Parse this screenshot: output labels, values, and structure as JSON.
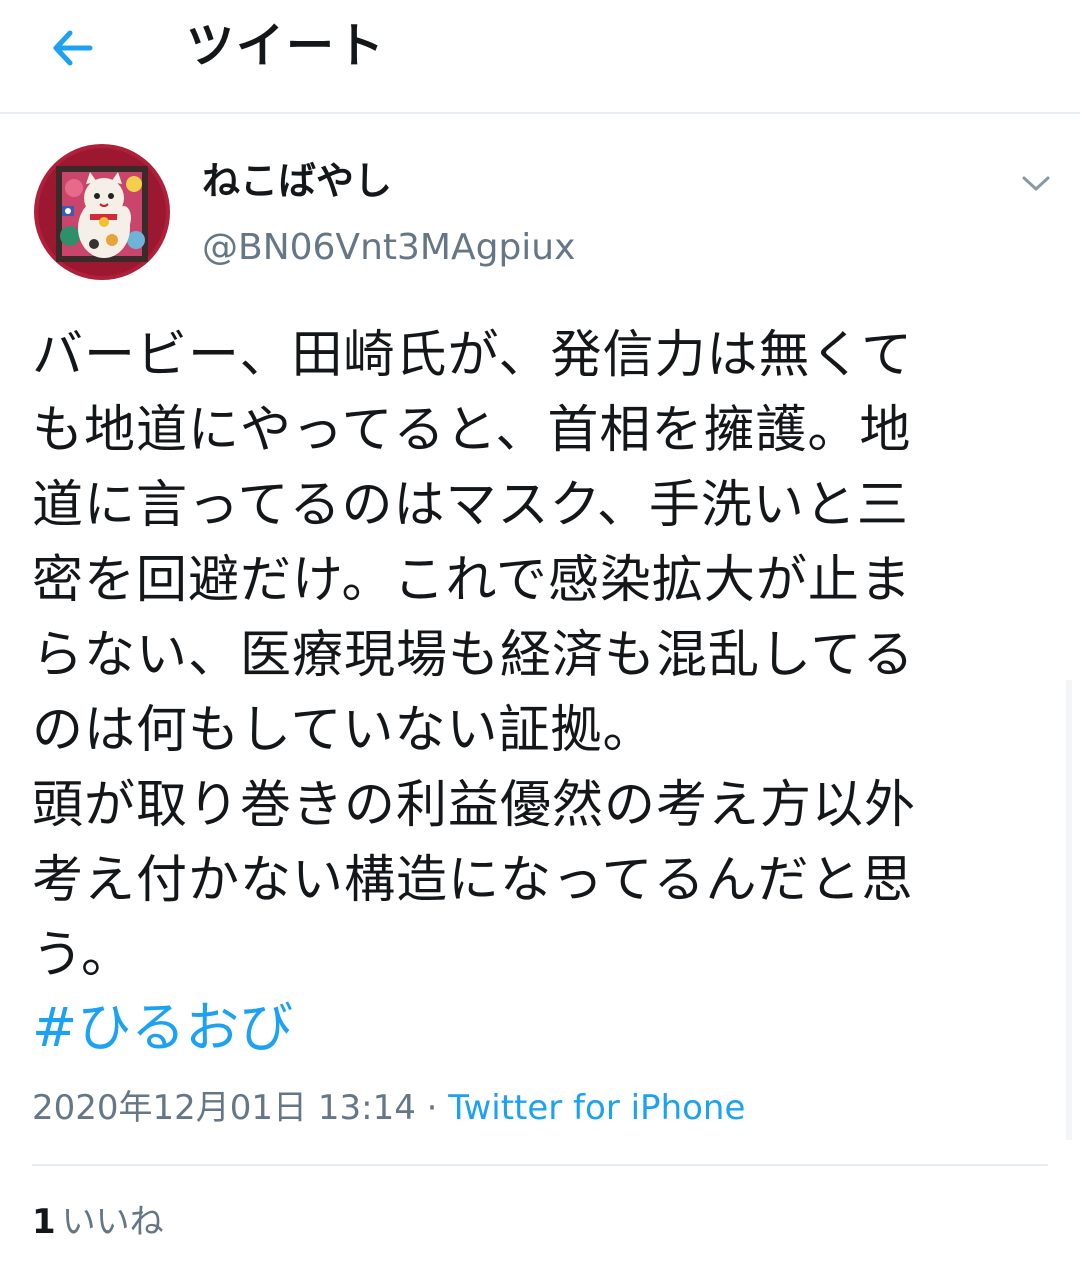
{
  "header": {
    "title": "ツイート",
    "back_icon": "back-arrow-icon",
    "accent": "#1da1f2"
  },
  "tweet": {
    "author": {
      "display_name": "ねこばやし",
      "handle": "@BN06Vnt3MAgpiux"
    },
    "text_lines": [
      "バービー、田崎氏が、発信力は無くて",
      "も地道にやってると、首相を擁護。地",
      "道に言ってるのはマスク、手洗いと三",
      "密を回避だけ。これで感染拡大が止ま",
      "らない、医療現場も経済も混乱してる",
      "のは何もしていない証拠。",
      "頭が取り巻きの利益優然の考え方以外",
      "考え付かない構造になってるんだと思",
      "う。"
    ],
    "hashtag": "#ひるおび",
    "timestamp": "2020年12月01日 13:14",
    "separator": " · ",
    "source": "Twitter for iPhone",
    "likes_count": "1",
    "likes_label": "いいね"
  },
  "colors": {
    "text": "#14171a",
    "secondary": "#657786",
    "link": "#1da1f2",
    "border": "#e6ecf0"
  }
}
